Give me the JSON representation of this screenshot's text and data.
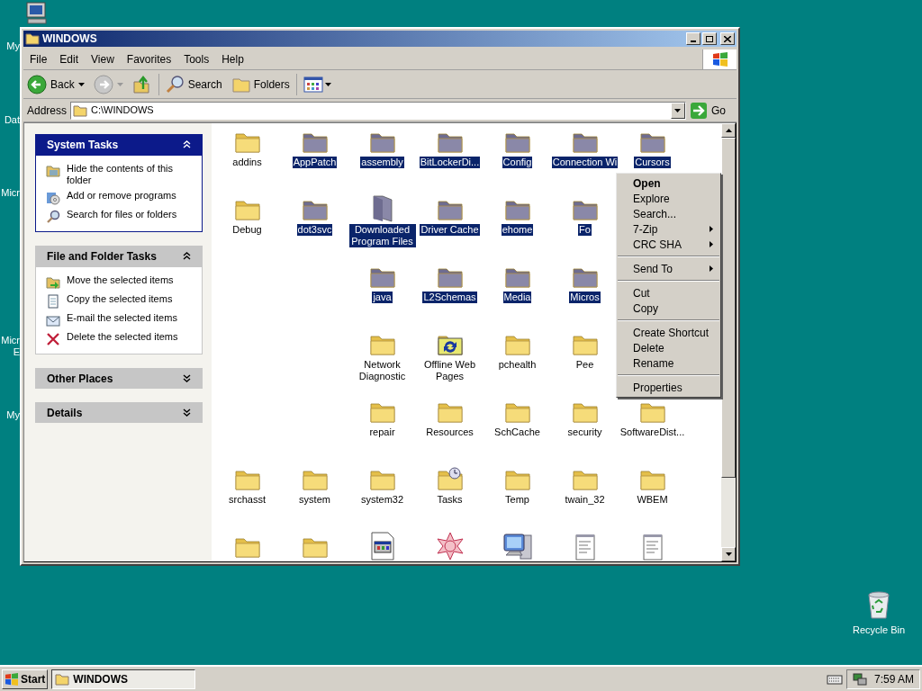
{
  "desktop_icons": [
    {
      "label": "My"
    },
    {
      "label": "Dat"
    },
    {
      "label": "Micr"
    },
    {
      "label": "Micr"
    },
    {
      "label": "E"
    },
    {
      "label": "My"
    }
  ],
  "recycle_bin": {
    "label": "Recycle Bin"
  },
  "window": {
    "title": "WINDOWS"
  },
  "menu_bar": [
    "File",
    "Edit",
    "View",
    "Favorites",
    "Tools",
    "Help"
  ],
  "toolbar": {
    "back": "Back",
    "search": "Search",
    "folders": "Folders"
  },
  "address": {
    "label": "Address",
    "value": "C:\\WINDOWS",
    "go": "Go"
  },
  "task_panels": [
    {
      "title": "System Tasks",
      "expanded": true,
      "primary": true,
      "items": [
        {
          "label": "Hide the contents of this folder",
          "kind": "hide"
        },
        {
          "label": "Add or remove programs",
          "kind": "programs"
        },
        {
          "label": "Search for files or folders",
          "kind": "search"
        }
      ]
    },
    {
      "title": "File and Folder Tasks",
      "expanded": true,
      "primary": false,
      "items": [
        {
          "label": "Move the selected items",
          "kind": "move"
        },
        {
          "label": "Copy the selected items",
          "kind": "copy"
        },
        {
          "label": "E-mail the selected items",
          "kind": "email"
        },
        {
          "label": "Delete the selected items",
          "kind": "delete"
        }
      ]
    },
    {
      "title": "Other Places",
      "expanded": false,
      "primary": false
    },
    {
      "title": "Details",
      "expanded": false,
      "primary": false
    }
  ],
  "files": [
    [
      {
        "label": "addins",
        "kind": "folder",
        "selected": false
      },
      {
        "label": "AppPatch",
        "kind": "folder",
        "selected": true
      },
      {
        "label": "assembly",
        "kind": "folder",
        "selected": true
      },
      {
        "label": "BitLockerDi...",
        "kind": "folder",
        "selected": true
      },
      {
        "label": "Config",
        "kind": "folder",
        "selected": true
      },
      {
        "label": "Connection Wi",
        "kind": "folder",
        "selected": true
      },
      {
        "label": "Cursors",
        "kind": "folder",
        "selected": true
      }
    ],
    [
      {
        "label": "Debug",
        "kind": "folder",
        "selected": false
      },
      {
        "label": "dot3svc",
        "kind": "folder",
        "selected": true
      },
      {
        "label": "Downloaded Program Files",
        "kind": "tall-folder",
        "selected": true
      },
      {
        "label": "Driver Cache",
        "kind": "folder",
        "selected": true
      },
      {
        "label": "ehome",
        "kind": "folder",
        "selected": true
      },
      {
        "label": "Fo",
        "kind": "folder",
        "selected": true
      }
    ],
    [
      {
        "kind": "gap"
      },
      {
        "kind": "gap"
      },
      {
        "label": "java",
        "kind": "folder",
        "selected": true
      },
      {
        "label": "L2Schemas",
        "kind": "folder",
        "selected": true
      },
      {
        "label": "Media",
        "kind": "folder",
        "selected": true
      },
      {
        "label": "Micros",
        "kind": "folder",
        "selected": true
      }
    ],
    [
      {
        "kind": "gap"
      },
      {
        "kind": "gap"
      },
      {
        "label": "Network Diagnostic",
        "kind": "folder",
        "selected": false
      },
      {
        "label": "Offline Web Pages",
        "kind": "sync-folder",
        "selected": false
      },
      {
        "label": "pchealth",
        "kind": "folder",
        "selected": false
      },
      {
        "label": "Pee",
        "kind": "folder",
        "selected": false
      }
    ],
    [
      {
        "kind": "gap"
      },
      {
        "kind": "gap"
      },
      {
        "label": "repair",
        "kind": "folder",
        "selected": false
      },
      {
        "label": "Resources",
        "kind": "folder",
        "selected": false
      },
      {
        "label": "SchCache",
        "kind": "folder",
        "selected": false
      },
      {
        "label": "security",
        "kind": "folder",
        "selected": false
      },
      {
        "label": "SoftwareDist...",
        "kind": "folder",
        "selected": false
      }
    ],
    [
      {
        "label": "srchasst",
        "kind": "folder",
        "selected": false
      },
      {
        "label": "system",
        "kind": "folder",
        "selected": false
      },
      {
        "label": "system32",
        "kind": "folder",
        "selected": false
      },
      {
        "label": "Tasks",
        "kind": "clock-folder",
        "selected": false
      },
      {
        "label": "Temp",
        "kind": "folder",
        "selected": false
      },
      {
        "label": "twain_32",
        "kind": "folder",
        "selected": false
      },
      {
        "label": "WBEM",
        "kind": "folder",
        "selected": false
      }
    ],
    [
      {
        "kind": "folder",
        "selected": false
      },
      {
        "kind": "folder",
        "selected": false
      },
      {
        "kind": "app-window",
        "selected": false
      },
      {
        "kind": "star",
        "selected": false
      },
      {
        "kind": "computer",
        "selected": false
      },
      {
        "kind": "text-file",
        "selected": false
      },
      {
        "kind": "text-file",
        "selected": false
      }
    ]
  ],
  "context_menu": [
    {
      "kind": "item",
      "label": "Open",
      "default": true,
      "submenu": false
    },
    {
      "kind": "item",
      "label": "Explore",
      "default": false,
      "submenu": false
    },
    {
      "kind": "item",
      "label": "Search...",
      "default": false,
      "submenu": false
    },
    {
      "kind": "item",
      "label": "7-Zip",
      "default": false,
      "submenu": true
    },
    {
      "kind": "item",
      "label": "CRC SHA",
      "default": false,
      "submenu": true
    },
    {
      "kind": "separator"
    },
    {
      "kind": "item",
      "label": "Send To",
      "default": false,
      "submenu": true
    },
    {
      "kind": "separator"
    },
    {
      "kind": "item",
      "label": "Cut",
      "default": false,
      "submenu": false
    },
    {
      "kind": "item",
      "label": "Copy",
      "default": false,
      "submenu": false
    },
    {
      "kind": "separator"
    },
    {
      "kind": "item",
      "label": "Create Shortcut",
      "default": false,
      "submenu": false
    },
    {
      "kind": "item",
      "label": "Delete",
      "default": false,
      "submenu": false
    },
    {
      "kind": "item",
      "label": "Rename",
      "default": false,
      "submenu": false
    },
    {
      "kind": "separator"
    },
    {
      "kind": "item",
      "label": "Properties",
      "default": false,
      "submenu": false
    }
  ],
  "taskbar": {
    "start": "Start",
    "tasks": [
      {
        "label": "WINDOWS",
        "selected": true
      }
    ],
    "clock": "7:59 AM"
  }
}
